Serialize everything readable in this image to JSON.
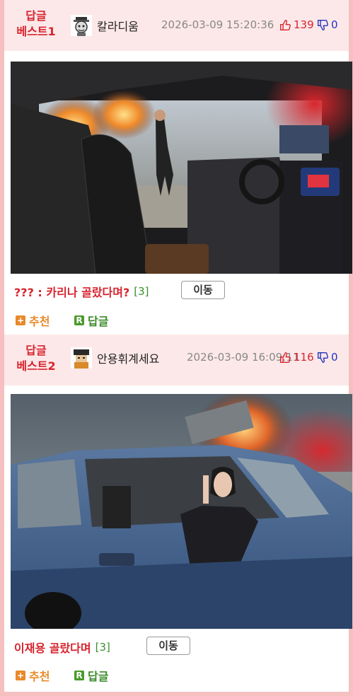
{
  "posts": [
    {
      "best_label": "답글\n베스트1",
      "nickname": "칼라디움",
      "datetime": "2026-03-09 15:20:36",
      "upvotes": "139",
      "downvotes": "0",
      "title": "??? : 카리나 골랐다며?",
      "comment_count": "[3]",
      "move_label": "이동",
      "recommend_label": "추천",
      "reply_label": "답글"
    },
    {
      "best_label": "답글\n베스트2",
      "nickname": "안용휘계세요",
      "datetime": "2026-03-09 16:09:11",
      "upvotes": "116",
      "downvotes": "0",
      "title": "이재용 골랐다며",
      "comment_count": "[3]",
      "move_label": "이동",
      "recommend_label": "추천",
      "reply_label": "답글"
    }
  ],
  "icons": {
    "recommend": "plus-icon",
    "reply": "reply-r-icon",
    "up": "thumbs-up-icon",
    "down": "thumbs-down-icon"
  },
  "colors": {
    "accent_red": "#d8242e",
    "border_pink": "#f6bfc0",
    "header_bg": "#fde8e9",
    "count_green": "#3a8f2a",
    "recommend_orange": "#e8892a",
    "down_blue": "#2233bb"
  }
}
